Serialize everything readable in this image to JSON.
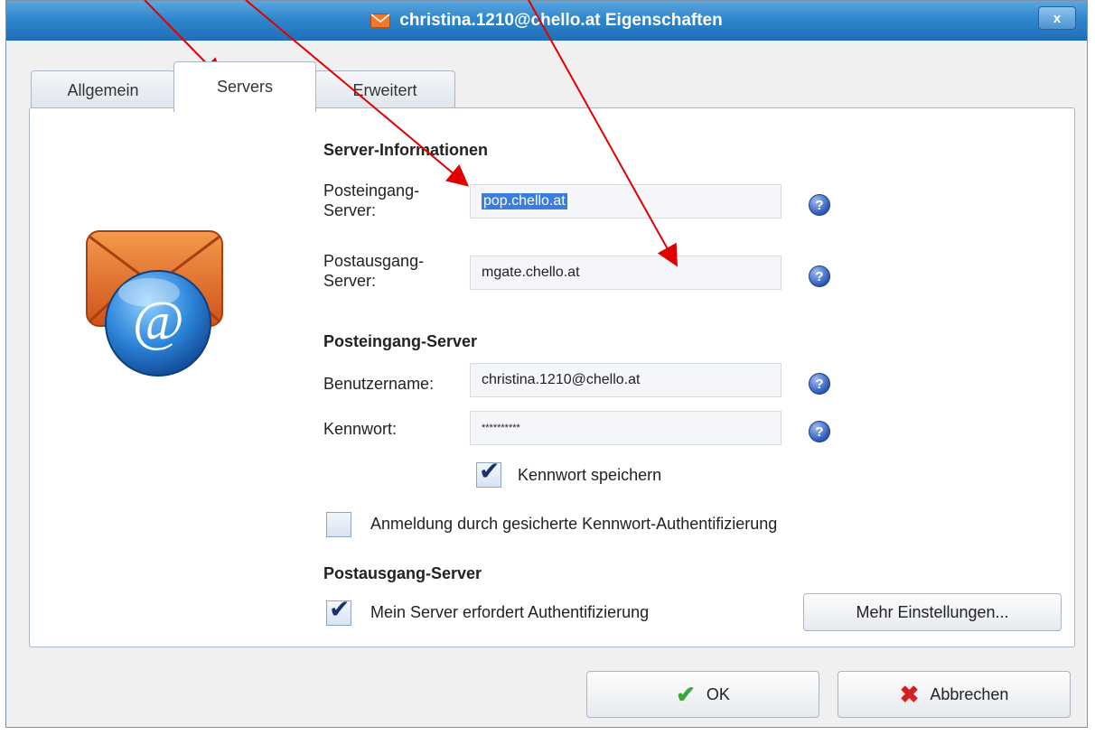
{
  "window": {
    "title": "christina.1210@chello.at Eigenschaften",
    "close_label": "x"
  },
  "tabs": [
    {
      "label": "Allgemein"
    },
    {
      "label": "Servers"
    },
    {
      "label": "Erweitert"
    }
  ],
  "server_info": {
    "heading": "Server-Informationen",
    "incoming_label_1": "Posteingang-",
    "incoming_label_2": "Server:",
    "incoming_value": "pop.chello.at",
    "outgoing_label_1": "Postausgang-",
    "outgoing_label_2": "Server:",
    "outgoing_value": "mgate.chello.at"
  },
  "incoming_server": {
    "heading": "Posteingang-Server",
    "username_label": "Benutzername:",
    "username_value": "christina.1210@chello.at",
    "password_label": "Kennwort:",
    "password_value": "**********",
    "save_password_label": "Kennwort speichern",
    "save_password_checked": true,
    "spa_label": "Anmeldung durch gesicherte Kennwort-Authentifizierung",
    "spa_checked": false
  },
  "outgoing_server": {
    "heading": "Postausgang-Server",
    "auth_label": "Mein Server erfordert Authentifizierung",
    "auth_checked": true,
    "more_settings_label": "Mehr Einstellungen..."
  },
  "help_icon_glyph": "?",
  "buttons": {
    "ok_label": "OK",
    "cancel_label": "Abbrechen"
  },
  "colors": {
    "accent": "#2f86cc",
    "selection": "#3b7ddd",
    "annotation_arrow": "#e00000"
  }
}
